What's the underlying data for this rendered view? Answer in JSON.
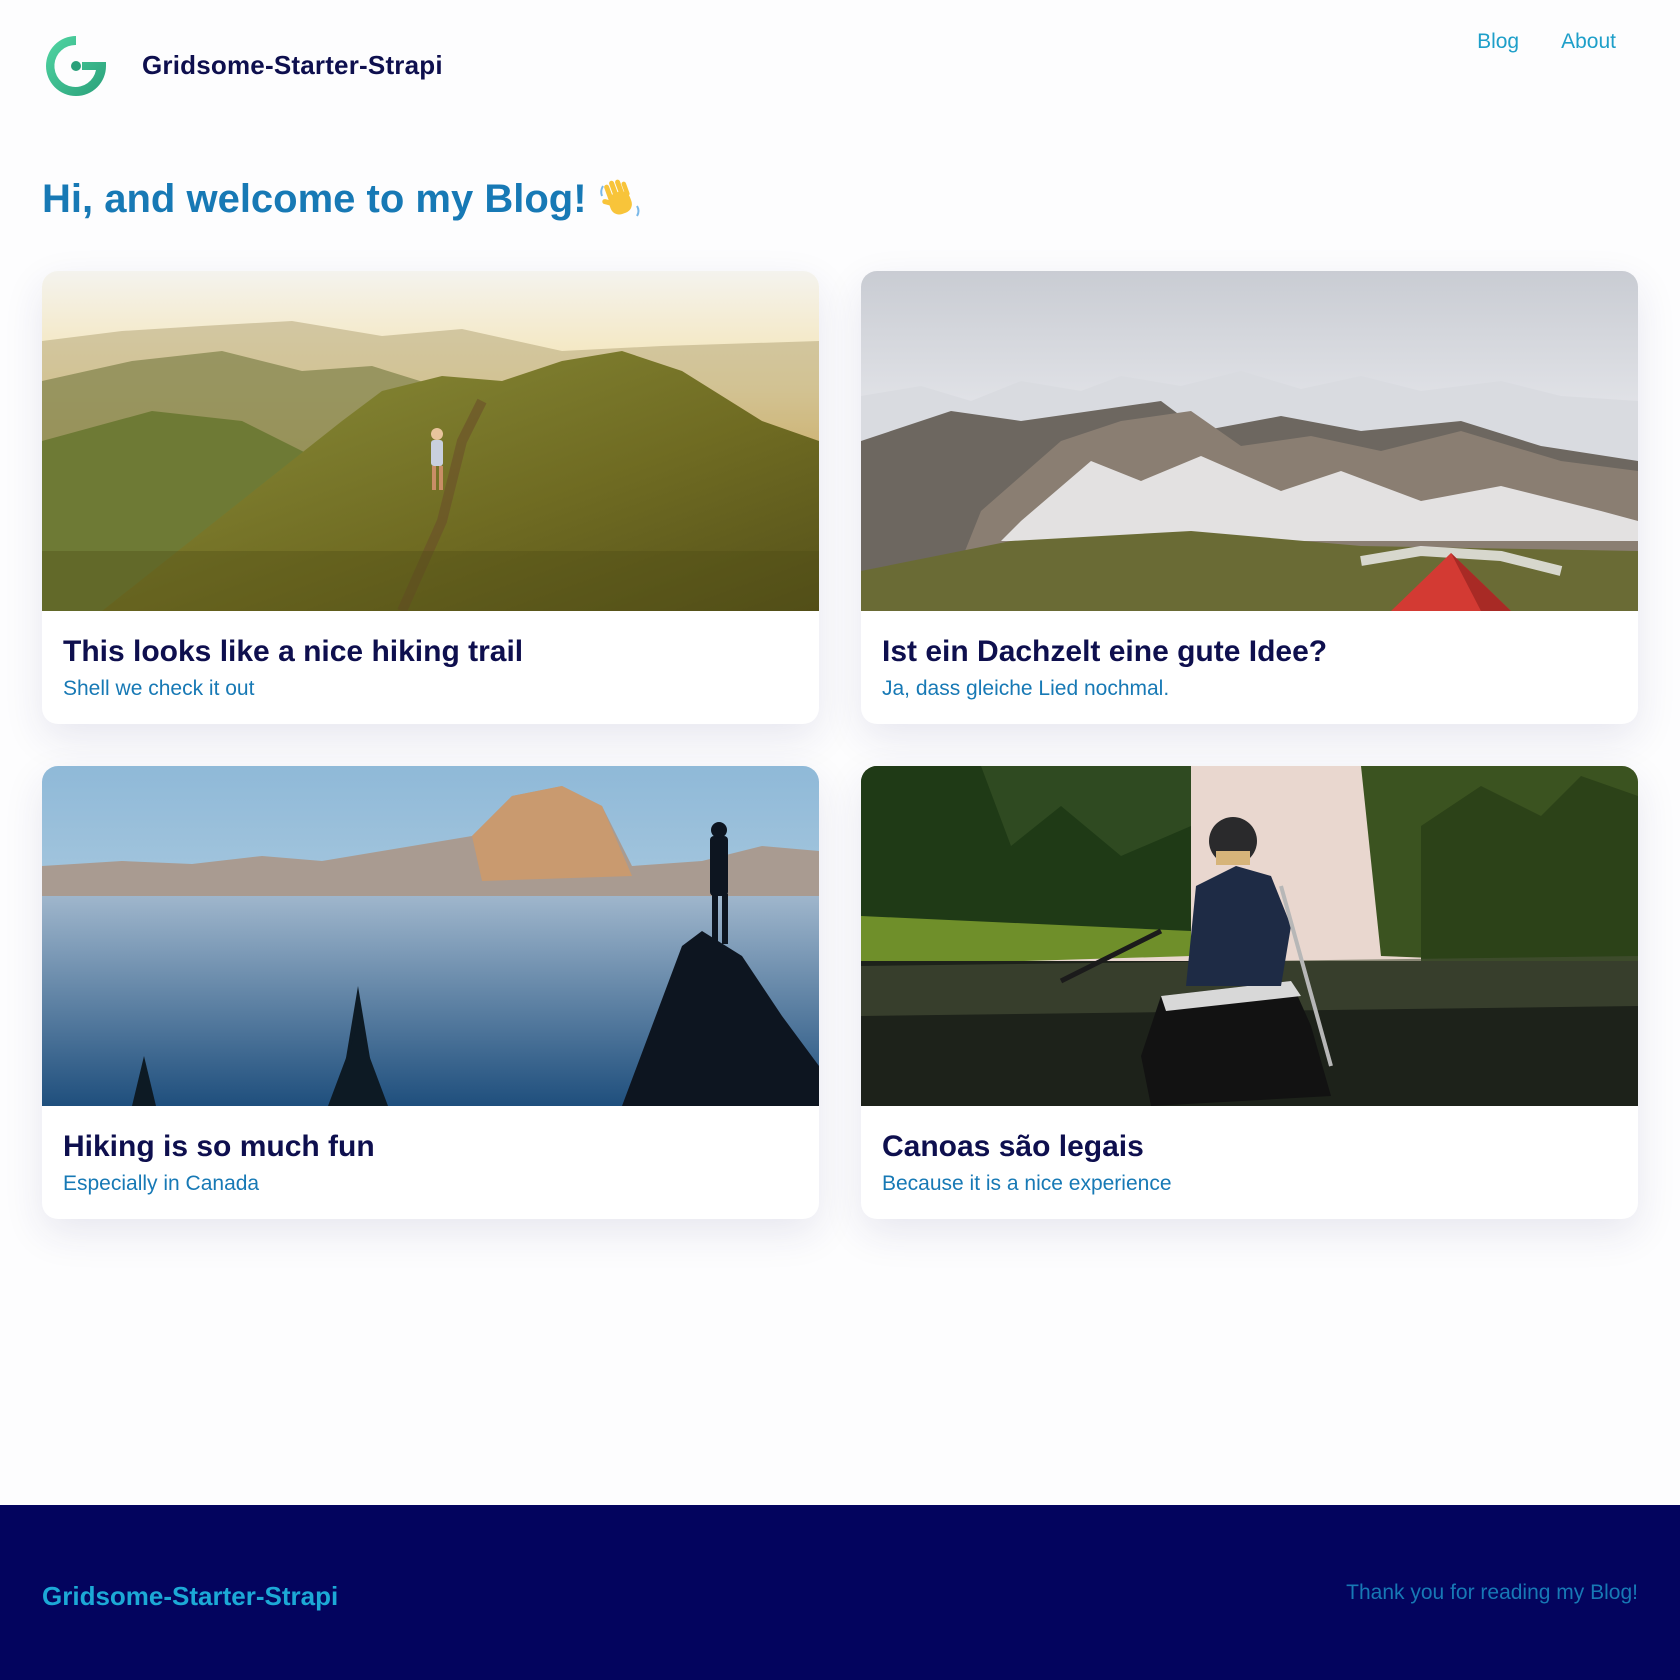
{
  "header": {
    "site_title": "Gridsome-Starter-Strapi",
    "nav": [
      {
        "label": "Blog"
      },
      {
        "label": "About"
      }
    ]
  },
  "intro": {
    "heading": "Hi, and welcome to my Blog!",
    "emoji_icon": "waving-hand-icon"
  },
  "posts": [
    {
      "title": "This looks like a nice hiking trail",
      "description": "Shell we check it out",
      "image": "mountain-ridge-hiker-photo"
    },
    {
      "title": "Ist ein Dachzelt eine gute Idee?",
      "description": "Ja, dass gleiche Lied nochmal.",
      "image": "snowy-mountains-tent-photo"
    },
    {
      "title": "Hiking is so much fun",
      "description": "Especially in Canada",
      "image": "half-dome-fog-photo"
    },
    {
      "title": "Canoas são legais",
      "description": "Because it is a nice experience",
      "image": "river-canoe-photo"
    }
  ],
  "footer": {
    "site_title": "Gridsome-Starter-Strapi",
    "note": "Thank you for reading my Blog!"
  },
  "colors": {
    "title_navy": "#0e0f4e",
    "accent_blue": "#1779b5",
    "link_cyan": "#1e9fc9",
    "footer_bg": "#03045e",
    "logo_green": "#3cc08f"
  }
}
